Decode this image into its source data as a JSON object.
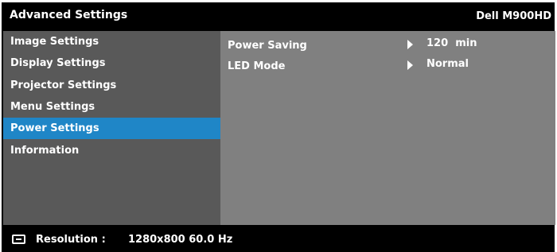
{
  "header": {
    "title": "Advanced Settings",
    "model": "Dell M900HD"
  },
  "menu": {
    "items": [
      {
        "label": "Image Settings",
        "selected": false
      },
      {
        "label": "Display Settings",
        "selected": false
      },
      {
        "label": "Projector Settings",
        "selected": false
      },
      {
        "label": "Menu Settings",
        "selected": false
      },
      {
        "label": "Power Settings",
        "selected": true
      },
      {
        "label": "Information",
        "selected": false
      }
    ]
  },
  "settings": [
    {
      "label": "Power Saving",
      "value": "120  min",
      "icon": "right-triangle-arrow-icon"
    },
    {
      "label": "LED Mode",
      "value": "Normal",
      "icon": "right-triangle-arrow-icon"
    }
  ],
  "footer": {
    "icon": "monitor-icon",
    "resolution_label": "Resolution :",
    "resolution_value": "1280x800 60.0 Hz"
  },
  "colors": {
    "background": "#000000",
    "sidebar": "#595959",
    "content_panel": "#808080",
    "selected_item": "#1f86c7",
    "text": "#ffffff"
  }
}
